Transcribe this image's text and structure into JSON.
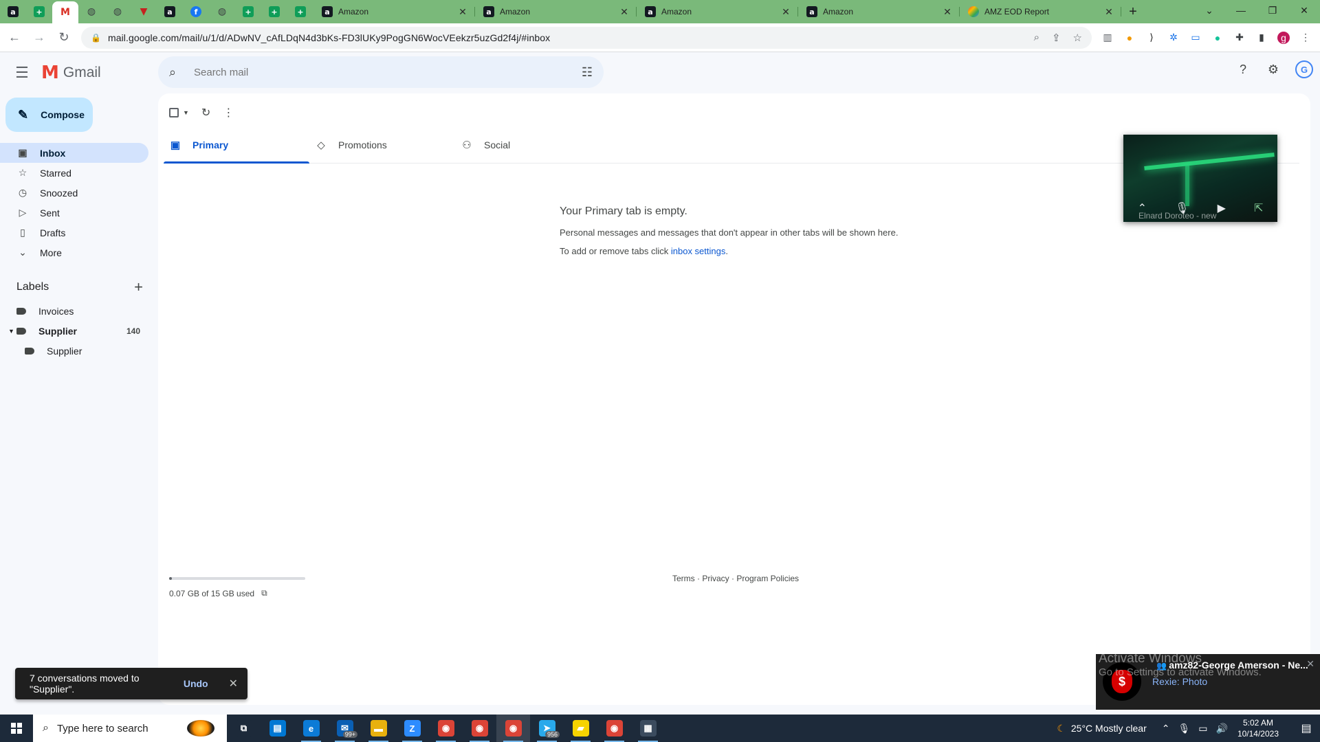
{
  "browser": {
    "pinned_tabs": [
      {
        "icon": "amazon-icon",
        "glyph": "a"
      },
      {
        "icon": "sheets-icon",
        "glyph": "+"
      },
      {
        "icon": "gmail-icon",
        "glyph": "M"
      },
      {
        "icon": "globe-icon",
        "glyph": "◍"
      },
      {
        "icon": "globe-icon",
        "glyph": "◍"
      },
      {
        "icon": "ttd-icon",
        "glyph": "▼"
      },
      {
        "icon": "amazon-icon",
        "glyph": "a"
      },
      {
        "icon": "facebook-icon",
        "glyph": "f"
      },
      {
        "icon": "globe-icon",
        "glyph": "◍"
      },
      {
        "icon": "sheets-icon",
        "glyph": "+"
      },
      {
        "icon": "sheets-icon",
        "glyph": "+"
      },
      {
        "icon": "sheets-icon",
        "glyph": "+"
      }
    ],
    "tabs": [
      {
        "title": "Amazon",
        "icon": "amazon-icon"
      },
      {
        "title": "Amazon",
        "icon": "amazon-icon"
      },
      {
        "title": "Amazon",
        "icon": "amazon-icon"
      },
      {
        "title": "Amazon",
        "icon": "amazon-icon"
      },
      {
        "title": "AMZ EOD Report",
        "icon": "report-icon"
      }
    ],
    "url": "mail.google.com/mail/u/1/d/ADwNV_cAfLDqN4d3bKs-FD3lUKy9PogGN6WocVEekzr5uzGd2f4j/#inbox",
    "profile_initial": "g"
  },
  "gmail": {
    "app_name": "Gmail",
    "search_placeholder": "Search mail",
    "account_initial": "G",
    "compose_label": "Compose",
    "nav": [
      {
        "label": "Inbox",
        "icon": "inbox-icon",
        "glyph": "▣",
        "active": true
      },
      {
        "label": "Starred",
        "icon": "star-icon",
        "glyph": "☆"
      },
      {
        "label": "Snoozed",
        "icon": "clock-icon",
        "glyph": "◷"
      },
      {
        "label": "Sent",
        "icon": "send-icon",
        "glyph": "▷"
      },
      {
        "label": "Drafts",
        "icon": "draft-icon",
        "glyph": "▯"
      },
      {
        "label": "More",
        "icon": "chevron-down-icon",
        "glyph": "⌄"
      }
    ],
    "labels_heading": "Labels",
    "labels": [
      {
        "name": "Invoices",
        "count": ""
      },
      {
        "name": "Supplier",
        "count": "140"
      },
      {
        "name": "Supplier",
        "count": ""
      }
    ],
    "category_tabs": [
      {
        "label": "Primary",
        "icon": "inbox-icon",
        "glyph": "▣"
      },
      {
        "label": "Promotions",
        "icon": "tag-icon",
        "glyph": "◇"
      },
      {
        "label": "Social",
        "icon": "people-icon",
        "glyph": "⚇"
      }
    ],
    "empty": {
      "heading": "Your Primary tab is empty.",
      "line1": "Personal messages and messages that don't appear in other tabs will be shown here.",
      "line2_prefix": "To add or remove tabs click ",
      "line2_link": "inbox settings",
      "line2_suffix": "."
    },
    "storage": {
      "text": "0.07 GB of 15 GB used",
      "fraction": 0.005
    },
    "footer": "Terms · Privacy · Program Policies",
    "snackbar": {
      "message": "7 conversations moved to \"Supplier\".",
      "undo": "Undo"
    }
  },
  "video_call": {
    "participant": "Elnard Doroteo - new"
  },
  "notification": {
    "title": "amz82-George Amerson - Ne...",
    "subtitle": "Rexie: Photo",
    "watermark_line1": "Activate Windows",
    "watermark_line2": "Go to Settings to activate Windows."
  },
  "taskbar": {
    "search_placeholder": "Type here to search",
    "apps": [
      {
        "icon": "task-view-icon",
        "glyph": "⧉",
        "color": "#1d2a3a"
      },
      {
        "icon": "store-icon",
        "glyph": "▤",
        "color": "#0078d4"
      },
      {
        "icon": "edge-icon",
        "glyph": "e",
        "color": "#0c7bd6"
      },
      {
        "icon": "mail-icon",
        "glyph": "✉",
        "color": "#0a5fb4",
        "badge": "99+"
      },
      {
        "icon": "folder-icon",
        "glyph": "▬",
        "color": "#e8b10e"
      },
      {
        "icon": "zoom-icon",
        "glyph": "Z",
        "color": "#2d8cff"
      },
      {
        "icon": "chrome-icon",
        "glyph": "◉",
        "color": "#db4437"
      },
      {
        "icon": "chrome-icon",
        "glyph": "◉",
        "color": "#db4437"
      },
      {
        "icon": "chrome-icon",
        "glyph": "◉",
        "color": "#db4437",
        "active": true
      },
      {
        "icon": "telegram-icon",
        "glyph": "➤",
        "color": "#29a9eb",
        "badge": "956"
      },
      {
        "icon": "sticky-notes-icon",
        "glyph": "▰",
        "color": "#f7d300"
      },
      {
        "icon": "chrome-icon",
        "glyph": "◉",
        "color": "#db4437"
      },
      {
        "icon": "calculator-icon",
        "glyph": "▦",
        "color": "#3b4b5e"
      }
    ],
    "weather": "25°C  Mostly clear",
    "time": "5:02 AM",
    "date": "10/14/2023"
  }
}
